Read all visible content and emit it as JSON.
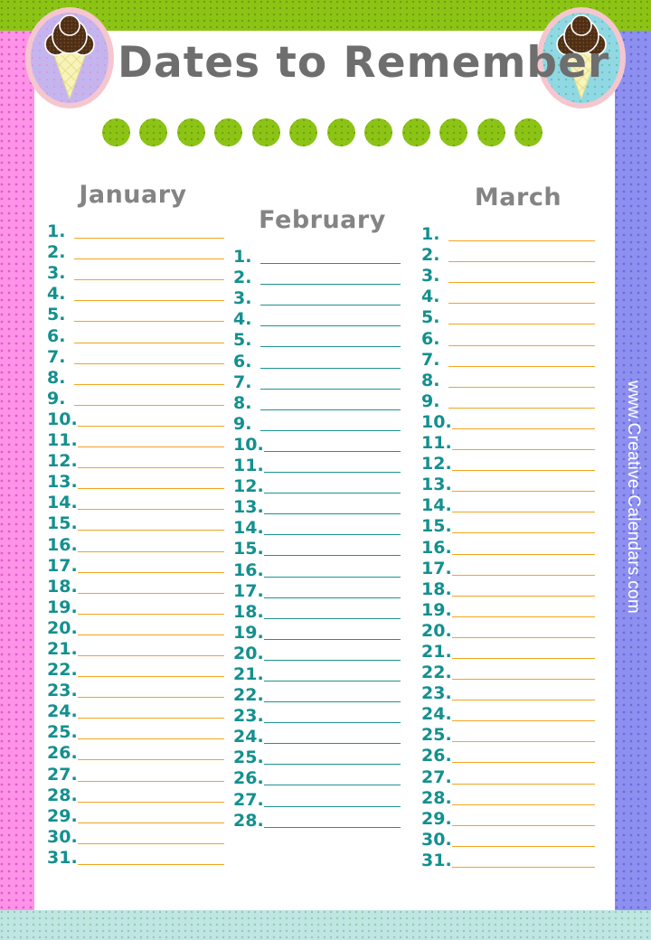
{
  "header": {
    "title": "Dates to Remember",
    "title_color": "#6e6e6e",
    "dot_count": 12,
    "dot_color": "#8cc415"
  },
  "branding": {
    "website": "www.Creative-Calendars.com",
    "website_text_color": "#ffffff"
  },
  "decor": {
    "top_band_color": "#8cc415",
    "left_band_color": "#ff93e8",
    "right_band_color": "#8e90f0",
    "bottom_band_color": "#bfe6e3",
    "card_color": "#ffffff",
    "medallion_left": {
      "icon": "ice-cream-cone-icon",
      "background_color": "#c5b5ef",
      "ring_color": "#f6c6cf",
      "scoop_color": "#5a3a20",
      "cone_color": "#f5f0b4"
    },
    "medallion_right": {
      "icon": "ice-cream-cone-icon",
      "background_color": "#8fd8e4",
      "ring_color": "#f6c6cf",
      "scoop_color": "#5a3a20",
      "cone_color": "#f5f0b4"
    }
  },
  "months": [
    {
      "name": "January",
      "number_color": "#13908f",
      "rule_color": "#f4a41f",
      "entries": [
        "1.",
        "2.",
        "3.",
        "4.",
        "5.",
        "6.",
        "7.",
        "8.",
        "9.",
        "10.",
        "11.",
        "12.",
        "13.",
        "14.",
        "15.",
        "16.",
        "17.",
        "18.",
        "19.",
        "20.",
        "21.",
        "22.",
        "23.",
        "24.",
        "25.",
        "26.",
        "27.",
        "28.",
        "29.",
        "30.",
        "31."
      ]
    },
    {
      "name": "February",
      "number_color": "#13908f",
      "rule_color": "#1d9291",
      "entries": [
        "1.",
        "2.",
        "3.",
        "4.",
        "5.",
        "6.",
        "7.",
        "8.",
        "9.",
        "10.",
        "11.",
        "12.",
        "13.",
        "14.",
        "15.",
        "16.",
        "17.",
        "18.",
        "19.",
        "20.",
        "21.",
        "22.",
        "23.",
        "24.",
        "25.",
        "26.",
        "27.",
        "28."
      ]
    },
    {
      "name": "March",
      "number_color": "#13908f",
      "rule_color": "#f4a41f",
      "entries": [
        "1.",
        "2.",
        "3.",
        "4.",
        "5.",
        "6.",
        "7.",
        "8.",
        "9.",
        "10.",
        "11.",
        "12.",
        "13.",
        "14.",
        "15.",
        "16.",
        "17.",
        "18.",
        "19.",
        "20.",
        "21.",
        "22.",
        "23.",
        "24.",
        "25.",
        "26.",
        "27.",
        "28.",
        "29.",
        "30.",
        "31."
      ]
    }
  ]
}
